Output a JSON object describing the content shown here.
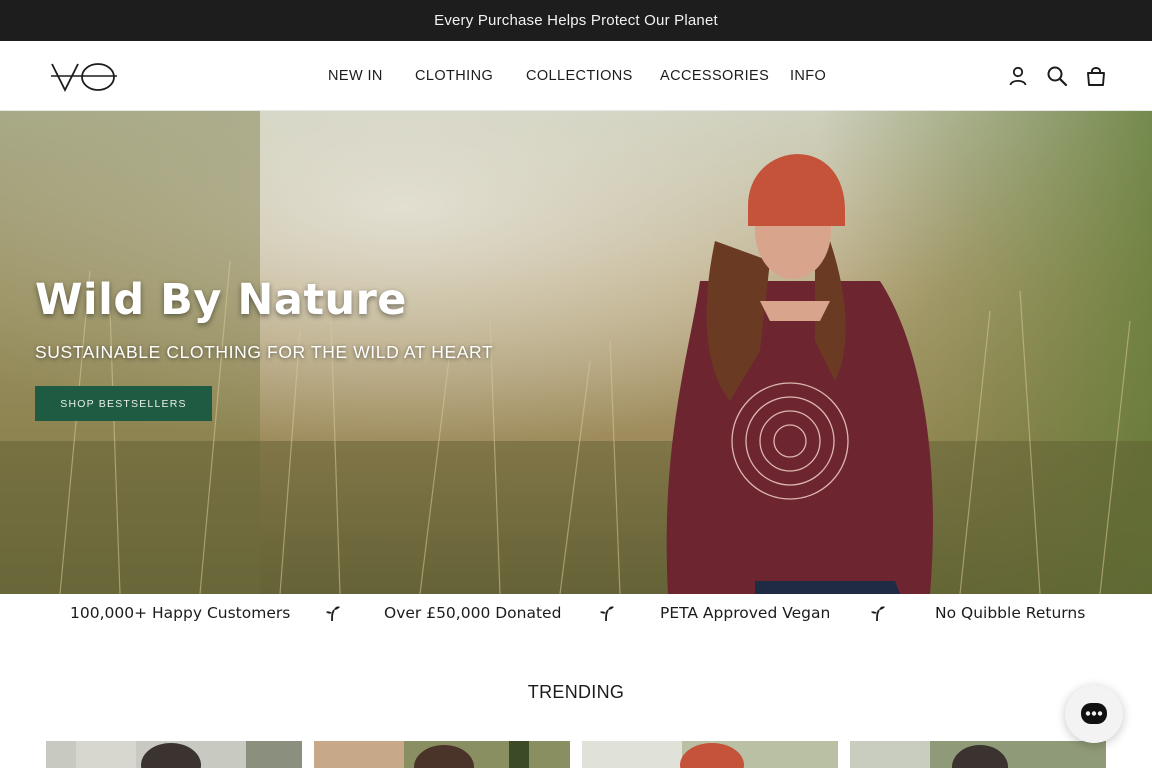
{
  "announcement": {
    "text": "Every Purchase Helps Protect Our Planet"
  },
  "header": {
    "logo_text": "VO",
    "nav": [
      {
        "label": "NEW IN"
      },
      {
        "label": "CLOTHING"
      },
      {
        "label": "COLLECTIONS"
      },
      {
        "label": "ACCESSORIES"
      },
      {
        "label": "INFO"
      }
    ],
    "icons": [
      "account-icon",
      "search-icon",
      "cart-icon"
    ]
  },
  "hero": {
    "title": "Wild By Nature",
    "subtitle": "SUSTAINABLE CLOTHING FOR THE WILD AT HEART",
    "button_label": "SHOP BESTSELLERS",
    "button_color": "#1f5b42"
  },
  "usps": [
    {
      "label": "100,000+ Happy Customers"
    },
    {
      "label": "Over £50,000 Donated"
    },
    {
      "label": "PETA Approved Vegan"
    },
    {
      "label": "No Quibble Returns"
    }
  ],
  "trending": {
    "heading": "TRENDING"
  },
  "chat": {
    "icon": "chat-icon"
  }
}
